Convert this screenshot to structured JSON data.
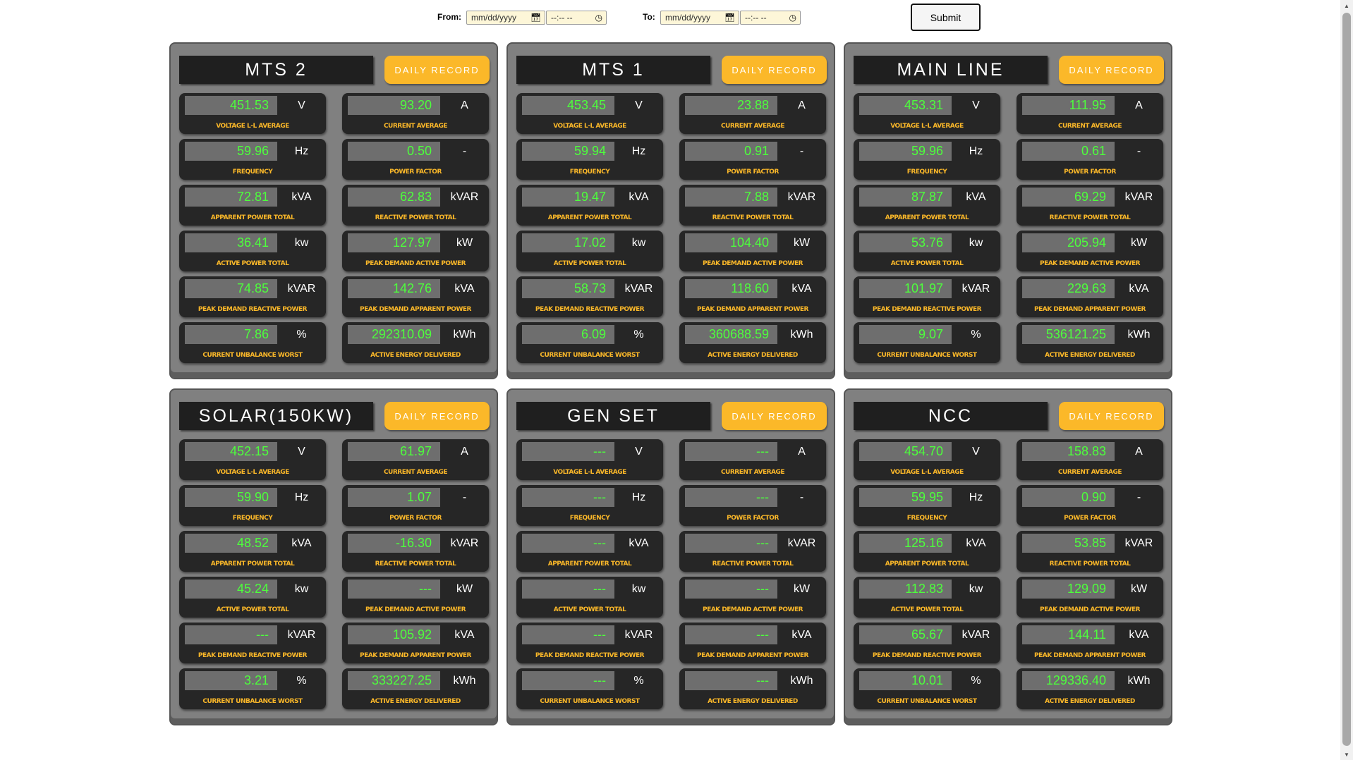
{
  "filter": {
    "from_label": "From:",
    "to_label": "To:",
    "date_placeholder": "mm/dd/yyyy",
    "time_placeholder": "--:-- --",
    "submit_label": "Submit"
  },
  "daily_record_label": "DAILY RECORD",
  "metric_labels": [
    "VOLTAGE L-L AVERAGE",
    "CURRENT AVERAGE",
    "FREQUENCY",
    "POWER FACTOR",
    "APPARENT POWER TOTAL",
    "REACTIVE POWER TOTAL",
    "ACTIVE POWER TOTAL",
    "PEAK DEMAND ACTIVE POWER",
    "PEAK DEMAND REACTIVE POWER",
    "PEAK DEMAND APPARENT POWER",
    "CURRENT UNBALANCE WORST",
    "ACTIVE ENERGY DELIVERED"
  ],
  "metric_units": [
    "V",
    "A",
    "Hz",
    "-",
    "kVA",
    "kVAR",
    "kw",
    "kW",
    "kVAR",
    "kVA",
    "%",
    "kWh"
  ],
  "panels": [
    {
      "title": "MTS 2",
      "values": [
        "451.53",
        "93.20",
        "59.96",
        "0.50",
        "72.81",
        "62.83",
        "36.41",
        "127.97",
        "74.85",
        "142.76",
        "7.86",
        "292310.09"
      ]
    },
    {
      "title": "MTS 1",
      "values": [
        "453.45",
        "23.88",
        "59.94",
        "0.91",
        "19.47",
        "7.88",
        "17.02",
        "104.40",
        "58.73",
        "118.60",
        "6.09",
        "360688.59"
      ]
    },
    {
      "title": "MAIN LINE",
      "values": [
        "453.31",
        "111.95",
        "59.96",
        "0.61",
        "87.87",
        "69.29",
        "53.76",
        "205.94",
        "101.97",
        "229.63",
        "9.07",
        "536121.25"
      ]
    },
    {
      "title": "SOLAR(150KW)",
      "values": [
        "452.15",
        "61.97",
        "59.90",
        "1.07",
        "48.52",
        "-16.30",
        "45.24",
        "---",
        "---",
        "105.92",
        "3.21",
        "333227.25"
      ]
    },
    {
      "title": "GEN SET",
      "values": [
        "---",
        "---",
        "---",
        "---",
        "---",
        "---",
        "---",
        "---",
        "---",
        "---",
        "---",
        "---"
      ]
    },
    {
      "title": "NCC",
      "values": [
        "454.70",
        "158.83",
        "59.95",
        "0.90",
        "125.16",
        "53.85",
        "112.83",
        "129.09",
        "65.67",
        "144.11",
        "10.01",
        "129336.40"
      ]
    }
  ],
  "colors": {
    "accent": "#fbb829",
    "value_text": "#4dff3c",
    "panel_bg": "#808080",
    "tile_bg": "#262626"
  }
}
